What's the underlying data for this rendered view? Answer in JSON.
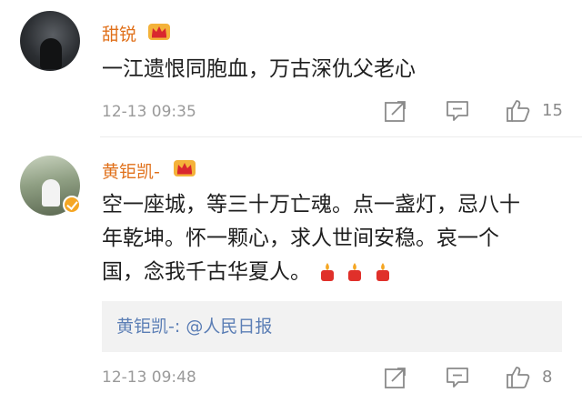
{
  "comments": [
    {
      "username": "甜锐",
      "text": "一江遗恨同胞血，万古深仇父老心",
      "timestamp": "12-13 09:35",
      "like_count": "15",
      "icons": {
        "avatar": "user-avatar",
        "badge": "crown-icon",
        "share": "share-icon",
        "reply": "reply-icon",
        "like": "thumbs-up-icon"
      }
    },
    {
      "username": "黄钜凯-",
      "text_lines": [
        "空一座城，等三十万亡魂。点一盏灯，忌八十",
        "年乾坤。怀一颗心，求人世间安稳。哀一个",
        "国，念我千古华夏人。"
      ],
      "emoji": "candle-icon",
      "quote": {
        "author": "黄钜凯-:",
        "mention": "@人民日报"
      },
      "timestamp": "12-13 09:48",
      "like_count": "8",
      "icons": {
        "avatar": "user-avatar",
        "badge": "crown-icon",
        "verified": "verified-badge-icon",
        "share": "share-icon",
        "reply": "reply-icon",
        "like": "thumbs-up-icon"
      }
    }
  ],
  "colors": {
    "username": "#e0701a",
    "link": "#5b7eb5",
    "meta": "#9a9a9a",
    "quote_bg": "#f2f2f2"
  }
}
